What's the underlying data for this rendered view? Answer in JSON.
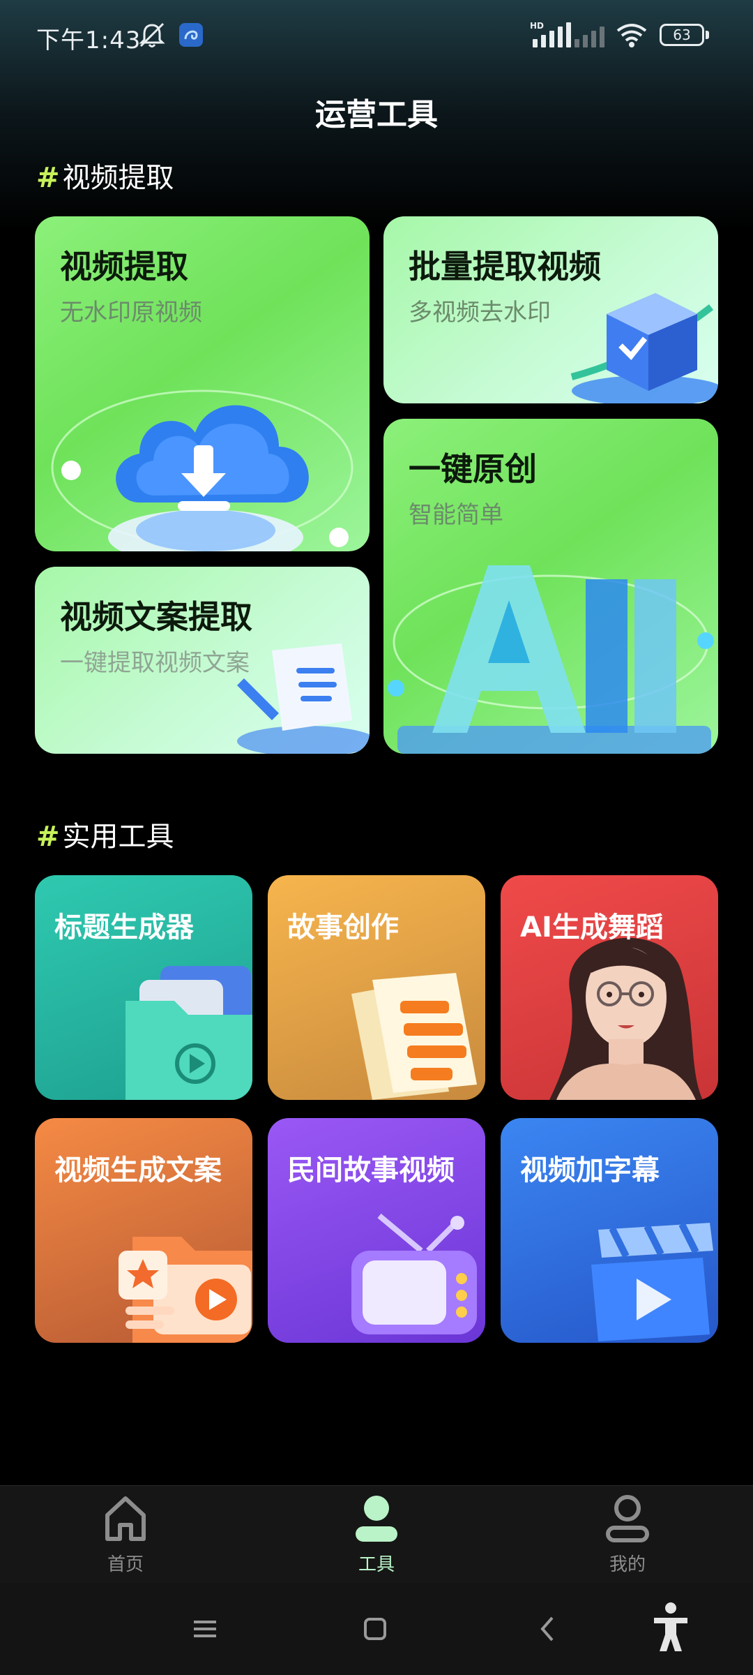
{
  "status_bar": {
    "time": "下午1:43",
    "network_label": "HD",
    "battery": "63"
  },
  "header": {
    "title": "运营工具"
  },
  "sections": {
    "video_extract": {
      "hash": "#",
      "title": "视频提取"
    },
    "tools": {
      "hash": "#",
      "title": "实用工具"
    }
  },
  "feature_cards": [
    {
      "title": "视频提取",
      "subtitle": "无水印原视频"
    },
    {
      "title": "批量提取视频",
      "subtitle": "多视频去水印"
    },
    {
      "title": "一键原创",
      "subtitle": "智能简单"
    },
    {
      "title": "视频文案提取",
      "subtitle": "一键提取视频文案"
    }
  ],
  "tools": [
    {
      "title": "标题生成器",
      "color": "#2bbfa8"
    },
    {
      "title": "故事创作",
      "color": "#e9a94a"
    },
    {
      "title": "AI生成舞蹈",
      "color": "#e84244"
    },
    {
      "title": "视频生成文案",
      "color": "#ee8040"
    },
    {
      "title": "民间故事视频",
      "color": "#8a4cec"
    },
    {
      "title": "视频加字幕",
      "color": "#3478e6"
    }
  ],
  "bottom_nav": [
    {
      "label": "首页",
      "icon": "home-icon",
      "active": false
    },
    {
      "label": "工具",
      "icon": "tools-icon",
      "active": true
    },
    {
      "label": "我的",
      "icon": "profile-icon",
      "active": false
    }
  ],
  "colors": {
    "accent_green": "#c6f15a",
    "active_nav": "#b9f3c7"
  }
}
